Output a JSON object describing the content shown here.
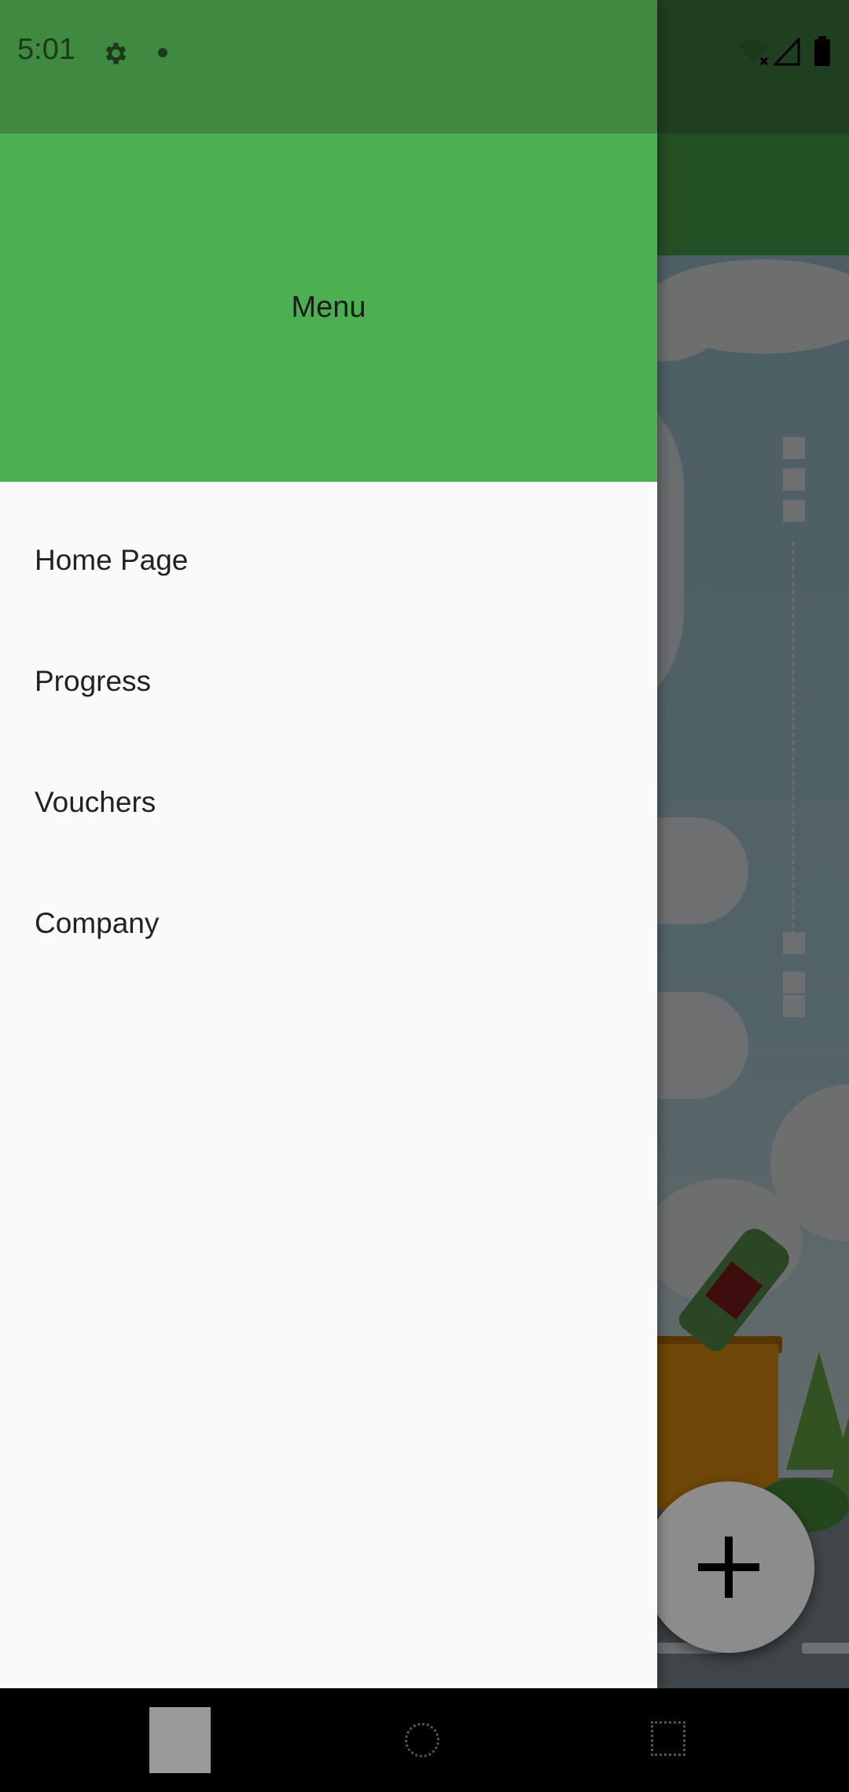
{
  "status_bar": {
    "time": "5:01",
    "icons": [
      "gear-icon",
      "notification-dot-icon",
      "wifi-off-icon",
      "cell-signal-icon",
      "battery-icon"
    ]
  },
  "drawer": {
    "header_title": "Menu",
    "items": [
      {
        "label": "Home Page"
      },
      {
        "label": "Progress"
      },
      {
        "label": "Vouchers"
      },
      {
        "label": "Company"
      }
    ]
  },
  "fab": {
    "icon": "plus-icon"
  },
  "nav_bar": {
    "icons": [
      "back-icon",
      "home-icon",
      "recents-icon"
    ]
  },
  "colors": {
    "primary": "#4caf50",
    "status_bar": "#3f8a40",
    "drawer_bg": "#fafafa"
  }
}
